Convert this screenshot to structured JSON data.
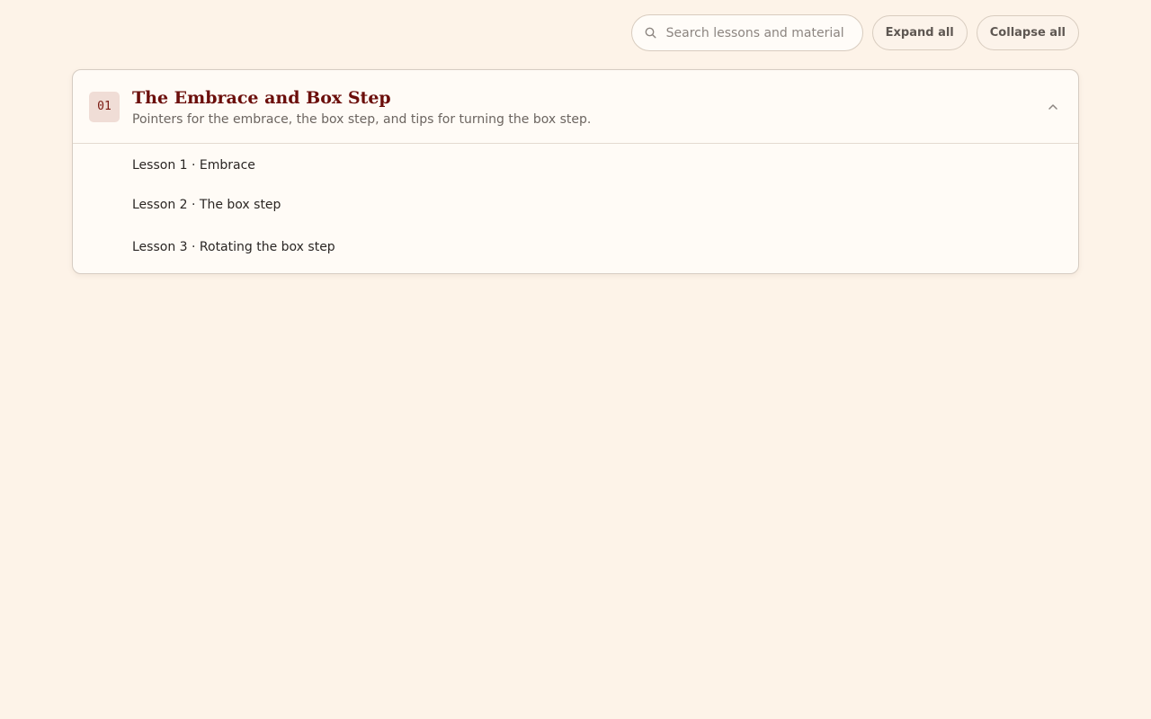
{
  "toolbar": {
    "search_placeholder": "Search lessons and material",
    "expand_all_label": "Expand all",
    "collapse_all_label": "Collapse all",
    "search_icon": "search-icon"
  },
  "module": {
    "number": "01",
    "title": "The Embrace and Box Step",
    "description": "Pointers for the embrace, the box step, and tips for turning the box step.",
    "expanded": true,
    "chevron_icon": "chevron-up-icon",
    "lessons": [
      {
        "label": "Lesson 1 · Embrace"
      },
      {
        "label": "Lesson 2 · The box step"
      },
      {
        "label": "Lesson 3 · Rotating the box step"
      }
    ]
  },
  "colors": {
    "background": "#fdf3e8",
    "accent": "#6b0e0b",
    "badge_bg": "#f0ddd6"
  }
}
